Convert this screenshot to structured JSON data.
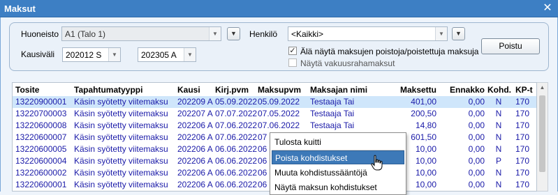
{
  "window": {
    "title": "Maksut",
    "close_glyph": "✕"
  },
  "filters": {
    "huoneisto_label": "Huoneisto",
    "huoneisto_value": "A1 (Talo 1)",
    "henkilo_label": "Henkilö",
    "henkilo_value": "<Kaikki>",
    "kausivali_label": "Kausiväli",
    "kausi_from": "202012 S",
    "kausi_to": "202305 A",
    "hide_removed_label": "Älä näytä maksujen poistoja/poistettuja maksuja",
    "hide_removed_checked": true,
    "show_deposit_label": "Näytä vakuusrahamaksut",
    "show_deposit_checked": false,
    "poistu_label": "Poistu"
  },
  "table": {
    "columns": [
      "Tosite",
      "Tapahtumatyyppi",
      "Kausi",
      "Kirj.pvm",
      "Maksupvm",
      "Maksajan nimi",
      "Maksettu",
      "Ennakko",
      "Kohd.",
      "KP-t"
    ],
    "rows": [
      [
        "13220900001",
        "Käsin syötetty viitemaksu",
        "202209 A",
        "05.09.2022",
        "05.09.2022",
        "Testaaja Tai",
        "401,00",
        "0,00",
        "N",
        "170"
      ],
      [
        "13220700003",
        "Käsin syötetty viitemaksu",
        "202207 A",
        "07.07.2022",
        "07.05.2022",
        "Testaaja Tai",
        "200,50",
        "0,00",
        "N",
        "170"
      ],
      [
        "13220600008",
        "Käsin syötetty viitemaksu",
        "202206 A",
        "07.06.2022",
        "07.06.2022",
        "Testaaja Tai",
        "14,80",
        "0,00",
        "N",
        "170"
      ],
      [
        "13220600007",
        "Käsin syötetty viitemaksu",
        "202206 A",
        "07.06.2022",
        "07",
        "",
        "601,50",
        "0,00",
        "N",
        "170"
      ],
      [
        "13220600005",
        "Käsin syötetty viitemaksu",
        "202206 A",
        "06.06.2022",
        "06",
        "",
        "10,00",
        "0,00",
        "N",
        "170"
      ],
      [
        "13220600004",
        "Käsin syötetty viitemaksu",
        "202206 A",
        "06.06.2022",
        "06",
        "",
        "10,00",
        "0,00",
        "P",
        "170"
      ],
      [
        "13220600002",
        "Käsin syötetty viitemaksu",
        "202206 A",
        "06.06.2022",
        "06",
        "",
        "10,00",
        "0,00",
        "N",
        "170"
      ],
      [
        "13220600001",
        "Käsin syötetty viitemaksu",
        "202206 A",
        "06.06.2022",
        "06",
        "",
        "10,00",
        "0,00",
        "N",
        "170"
      ]
    ],
    "selected_row": 0
  },
  "context_menu": {
    "items": [
      "Tulosta kuitti",
      "Poista kohdistukset",
      "Muuta kohdistussääntöjä",
      "Näytä maksun kohdistukset"
    ],
    "highlighted": 1
  },
  "colors": {
    "title_bar": "#3d7fc4",
    "row_text": "#1a1aa8",
    "selection": "#cfe6fb",
    "menu_highlight": "#3d79b8"
  }
}
